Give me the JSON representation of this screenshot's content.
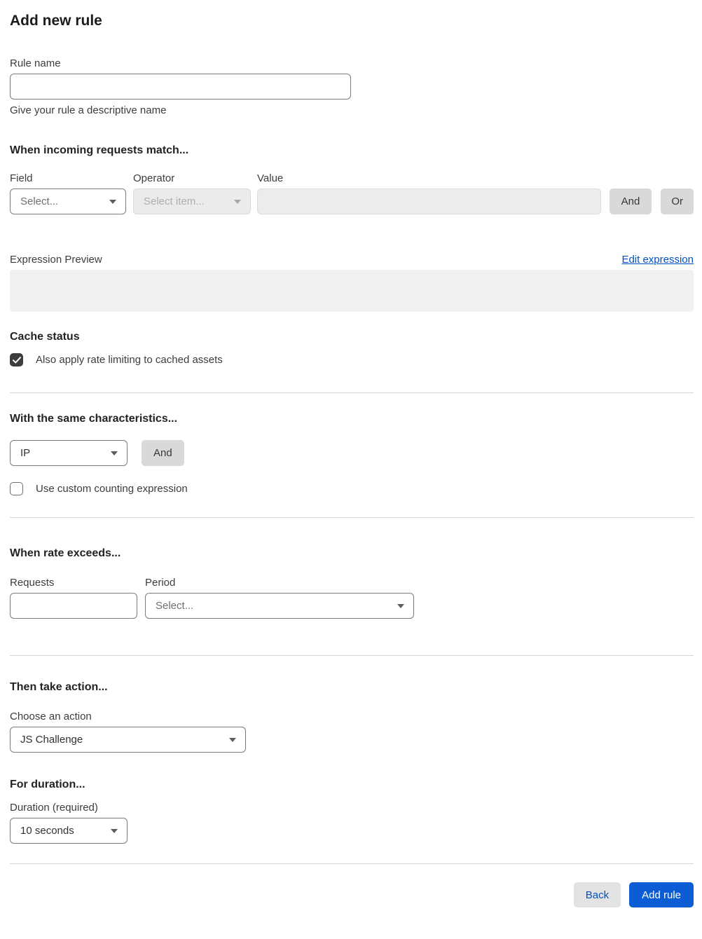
{
  "page": {
    "title": "Add new rule"
  },
  "rule_name": {
    "label": "Rule name",
    "value": "",
    "help": "Give your rule a descriptive name"
  },
  "match": {
    "heading": "When incoming requests match...",
    "field": {
      "label": "Field",
      "value": "Select..."
    },
    "operator": {
      "label": "Operator",
      "value": "Select item..."
    },
    "value": {
      "label": "Value",
      "value": ""
    },
    "and_label": "And",
    "or_label": "Or"
  },
  "expression": {
    "label": "Expression Preview",
    "edit_link": "Edit expression",
    "preview": ""
  },
  "cache": {
    "heading": "Cache status",
    "checkbox_label": "Also apply rate limiting to cached assets",
    "checked": true
  },
  "characteristics": {
    "heading": "With the same characteristics...",
    "select_value": "IP",
    "and_label": "And",
    "checkbox_label": "Use custom counting expression",
    "checked": false
  },
  "rate": {
    "heading": "When rate exceeds...",
    "requests": {
      "label": "Requests",
      "value": ""
    },
    "period": {
      "label": "Period",
      "value": "Select..."
    }
  },
  "action": {
    "heading": "Then take action...",
    "label": "Choose an action",
    "value": "JS Challenge"
  },
  "duration": {
    "heading": "For duration...",
    "label": "Duration (required)",
    "value": "10 seconds"
  },
  "footer": {
    "back_label": "Back",
    "add_label": "Add rule"
  },
  "colors": {
    "primary_blue": "#0b5cd5",
    "link_blue": "#0051c3"
  }
}
